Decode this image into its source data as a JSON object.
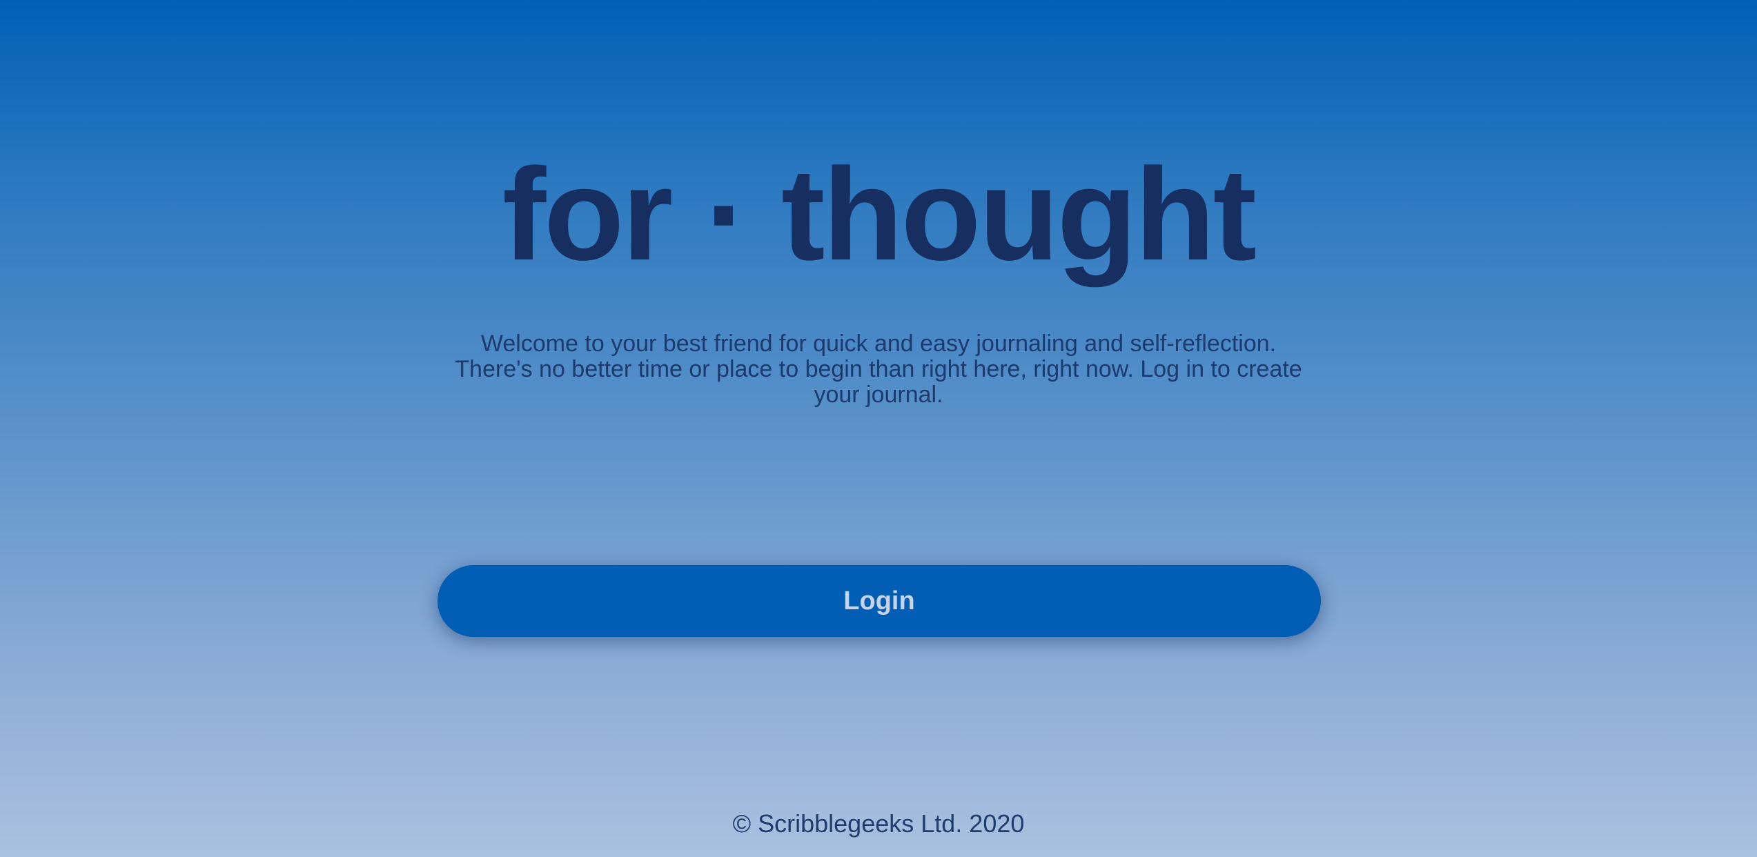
{
  "app": {
    "title": "for · thought"
  },
  "intro": {
    "welcome_text": "Welcome to your best friend for quick and easy journaling and self-reflection. There's no better time or place to begin than right here, right now. Log in to create your journal."
  },
  "actions": {
    "login_label": "Login"
  },
  "footer": {
    "copyright": "© Scribblegeeks Ltd. 2020"
  },
  "colors": {
    "background_top": "#0160b6",
    "background_bottom": "#aac0df",
    "title_text": "#172f60",
    "button_bg": "#025db4",
    "button_text": "#c7d3e6"
  }
}
